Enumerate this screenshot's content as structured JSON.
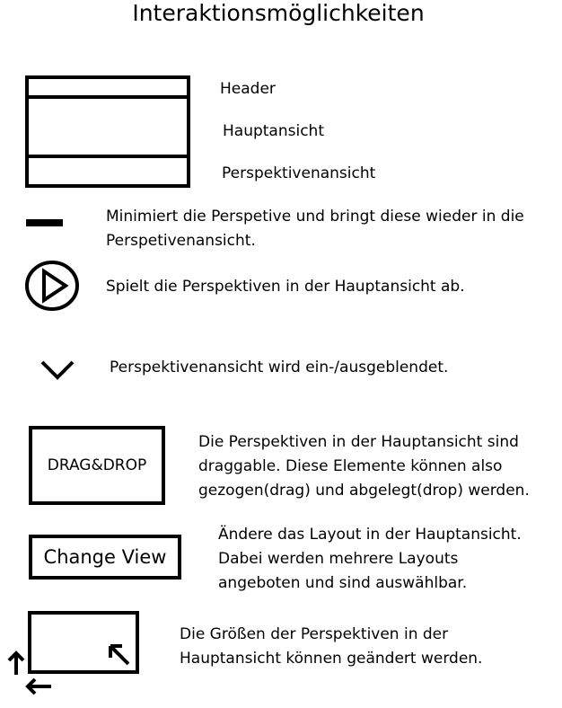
{
  "title": "Interaktionsmöglichkeiten",
  "layout_legend": {
    "header_label": "Header",
    "main_label": "Hauptansicht",
    "perspective_label": "Perspektivenansicht"
  },
  "items": {
    "minimize": {
      "line1": "Minimiert die Perspetive und bringt diese wieder in die",
      "line2": "Perspetivenansicht."
    },
    "play": {
      "line1": "Spielt die Perspektiven in der Hauptansicht ab."
    },
    "toggle": {
      "line1": "Perspektivenansicht wird ein-/ausgeblendet."
    },
    "dragdrop": {
      "button_label": "DRAG&DROP",
      "line1": "Die Perspektiven in der Hauptansicht sind",
      "line2": "draggable. Diese Elemente können also",
      "line3": "gezogen(drag) und abgelegt(drop) werden."
    },
    "change_view": {
      "button_label": "Change View",
      "line1": "Ändere das Layout in der Hauptansicht.",
      "line2": "Dabei werden mehrere Layouts",
      "line3": "angeboten und sind auswählbar."
    },
    "resize": {
      "line1": "Die Größen der Perspektiven in der",
      "line2": "Hauptansicht können geändert werden."
    }
  },
  "icons": [
    "minimize-icon",
    "play-icon",
    "chevron-down-icon",
    "resize-arrow-icon",
    "arrow-up-icon",
    "arrow-left-icon"
  ]
}
